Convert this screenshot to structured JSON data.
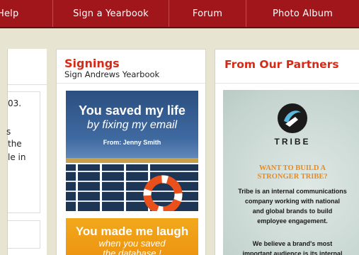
{
  "nav": {
    "items": [
      {
        "label": "Help"
      },
      {
        "label": "Sign a Yearbook"
      },
      {
        "label": "Forum"
      },
      {
        "label": "Photo Album"
      }
    ]
  },
  "left_panel": {
    "fragments": [
      "03.",
      "s",
      "the",
      "le in"
    ]
  },
  "signings": {
    "title": "Signings",
    "subtitle": "Sign Andrews Yearbook",
    "card1": {
      "line1": "You saved my life",
      "line2": "by fixing my email",
      "from": "From: Jenny Smith"
    },
    "card2": {
      "line1": "You made me laugh",
      "line2": "when you saved",
      "line3": "the database !"
    }
  },
  "partners": {
    "title": "From Our Partners",
    "brand": "TRIBE",
    "headline_line1": "WANT TO BUILD A",
    "headline_line2": "STRONGER TRIBE?",
    "body_lines": [
      "Tribe is an internal communications",
      "company working with national",
      "and global brands to build",
      "employee engagement."
    ],
    "body2_lines": [
      "We believe a brand's most",
      "important audience is its internal"
    ]
  },
  "colors": {
    "nav_bg": "#a1161b",
    "accent_red": "#d62a17",
    "page_bg": "#e7e5d2",
    "headline_orange": "#e88b1f"
  }
}
